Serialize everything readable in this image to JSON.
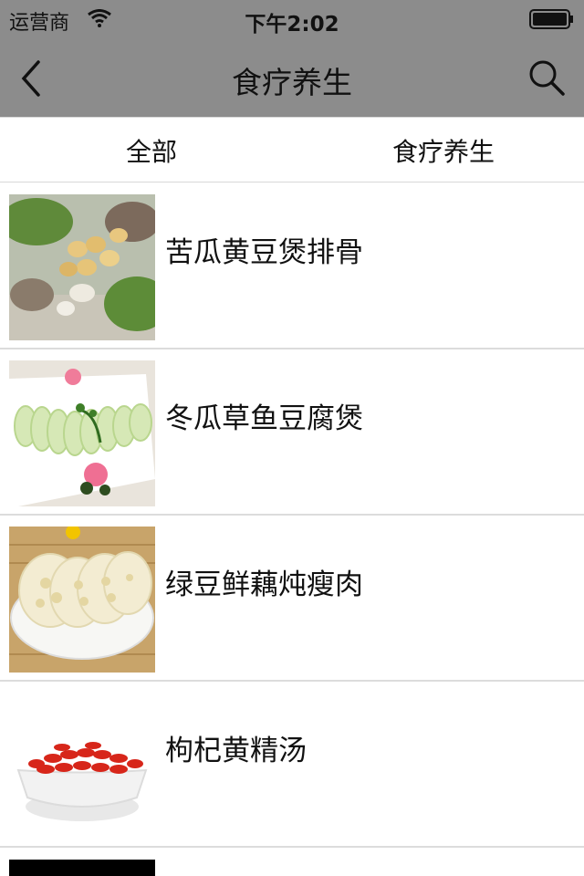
{
  "status_bar": {
    "carrier": "运营商",
    "time": "下午2:02"
  },
  "nav": {
    "title": "食疗养生",
    "back_icon": "back-chevron-icon",
    "search_icon": "search-icon"
  },
  "tabs": [
    {
      "label": "全部"
    },
    {
      "label": "食疗养生"
    }
  ],
  "items": [
    {
      "title": "苦瓜黄豆煲排骨",
      "image": "bitter-melon-soybean-ribs-image"
    },
    {
      "title": "冬瓜草鱼豆腐煲",
      "image": "winter-melon-slices-image"
    },
    {
      "title": "绿豆鲜藕炖瘦肉",
      "image": "lotus-root-slices-image"
    },
    {
      "title": "枸杞黄精汤",
      "image": "goji-berries-bowl-image"
    }
  ]
}
